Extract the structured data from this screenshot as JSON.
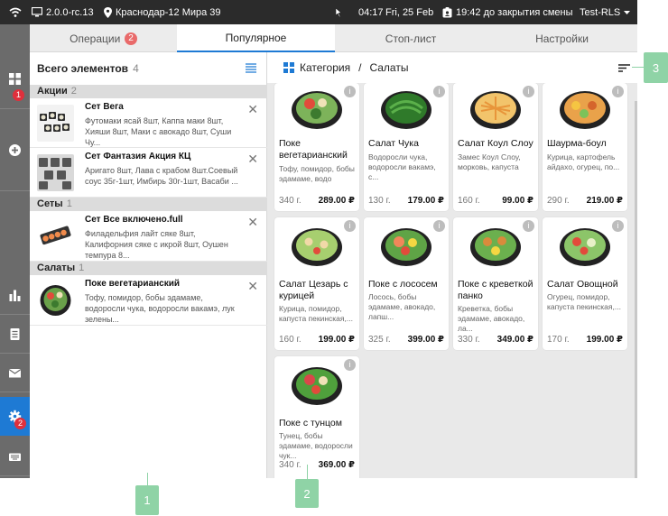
{
  "topbar": {
    "version": "2.0.0-rc.13",
    "location": "Краснодар-12 Мира 39",
    "time": "04:17",
    "date": "Fri, 25 Feb",
    "shift": "19:42 до закрытия смены",
    "user": "Test-RLS"
  },
  "sidebar": {
    "badge_top": "1",
    "badge_settings": "2"
  },
  "tabs": [
    {
      "label": "Операции",
      "count": "2"
    },
    {
      "label": "Популярное"
    },
    {
      "label": "Стоп-лист"
    },
    {
      "label": "Настройки"
    }
  ],
  "left": {
    "header": "Всего элементов",
    "count": "4",
    "groups": [
      {
        "name": "Акции",
        "count": "2"
      },
      {
        "name": "Сеты",
        "count": "1"
      },
      {
        "name": "Салаты",
        "count": "1"
      }
    ],
    "items": [
      {
        "title": "Сет Вега",
        "desc": "Футомаки ясай 8шт, Каппа маки 8шт, Хияши 8шт, Маки с авокадо 8шт, Суши Чу..."
      },
      {
        "title": "Сет Фантазия Акция КЦ",
        "desc": "Аригато 8шт, Лава с крабом 8шт.Соевый соус 35г-1шт, Имбирь 30г-1шт, Васаби ..."
      },
      {
        "title": "Сет Все включено.full",
        "desc": "Филадельфия лайт сяке 8шт, Калифорния сяке с икрой 8шт, Оушен темпура 8..."
      },
      {
        "title": "Поке вегетарианский",
        "desc": "Тофу, помидор, бобы эдамаме, водоросли чука, водоросли вакамэ, лук зелены..."
      }
    ]
  },
  "breadcrumb": {
    "category": "Категория",
    "sep": "/",
    "current": "Салаты"
  },
  "cards": [
    {
      "name": "Поке вегетарианский",
      "desc": "Тофу, помидор, бобы эдамаме, водо",
      "weight": "340 г.",
      "price": "289.00 ₽"
    },
    {
      "name": "Салат Чука",
      "desc": "Водоросли чука, водоросли вакамэ, с...",
      "weight": "130 г.",
      "price": "179.00 ₽"
    },
    {
      "name": "Салат Коул Слоу",
      "desc": "Замес Коул Слоу, морковь, капуста",
      "weight": "160 г.",
      "price": "99.00 ₽"
    },
    {
      "name": "Шаурма-боул",
      "desc": "Курица, картофель айдахо, огурец, по...",
      "weight": "290 г.",
      "price": "219.00 ₽"
    },
    {
      "name": "Салат Цезарь с курицей",
      "desc": "Курица, помидор, капуста пекинская,...",
      "weight": "160 г.",
      "price": "199.00 ₽"
    },
    {
      "name": "Поке с лососем",
      "desc": "Лосось, бобы эдамаме, авокадо, лапш...",
      "weight": "325 г.",
      "price": "399.00 ₽"
    },
    {
      "name": "Поке с креветкой панко",
      "desc": "Креветка, бобы эдамаме, авокадо, ла...",
      "weight": "330 г.",
      "price": "349.00 ₽"
    },
    {
      "name": "Салат Овощной",
      "desc": "Огурец, помидор, капуста пекинская,...",
      "weight": "170 г.",
      "price": "199.00 ₽"
    },
    {
      "name": "Поке с тунцом",
      "desc": "Тунец, бобы эдамаме, водоросли чук...",
      "weight": "340 г.",
      "price": "369.00 ₽"
    }
  ],
  "markers": [
    "1",
    "2",
    "3"
  ],
  "colors": {
    "accent": "#1e7ad4",
    "topbar": "#2b2b2b",
    "sidebar": "#6b6b6b",
    "marker": "#8fd3a6",
    "badge": "#e0303c"
  }
}
